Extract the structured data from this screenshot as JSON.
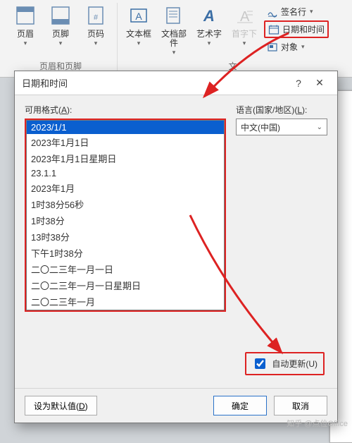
{
  "ribbon": {
    "group1": {
      "title": "页眉和页脚",
      "btns": [
        {
          "label": "页眉"
        },
        {
          "label": "页脚"
        },
        {
          "label": "页码"
        }
      ]
    },
    "group2": {
      "title": "文",
      "btns": [
        {
          "label": "文本框"
        },
        {
          "label": "文档部件"
        },
        {
          "label": "艺术字"
        },
        {
          "label": "首字下"
        }
      ]
    },
    "right": {
      "signature": "签名行",
      "datetime": "日期和时间",
      "object": "对象"
    }
  },
  "dialog": {
    "title": "日期和时间",
    "formats_label": "可用格式(",
    "formats_label_ul": "A",
    "formats_label_after": "):",
    "lang_label": "语言(国家/地区)(",
    "lang_label_ul": "L",
    "lang_label_after": "):",
    "lang_value": "中文(中国)",
    "auto_update": "自动更新(",
    "auto_update_ul": "U",
    "auto_update_after": ")",
    "set_default": "设为默认值(",
    "set_default_ul": "D",
    "set_default_after": ")",
    "ok": "确定",
    "cancel": "取消",
    "formats": [
      "2023/1/1",
      "2023年1月1日",
      "2023年1月1日星期日",
      "23.1.1",
      "2023年1月",
      "1时38分56秒",
      "1时38分",
      "13时38分",
      "下午1时38分",
      "二〇二三年一月一日",
      "二〇二三年一月一日星期日",
      "二〇二三年一月"
    ]
  },
  "watermark": "知乎 @点位Office"
}
